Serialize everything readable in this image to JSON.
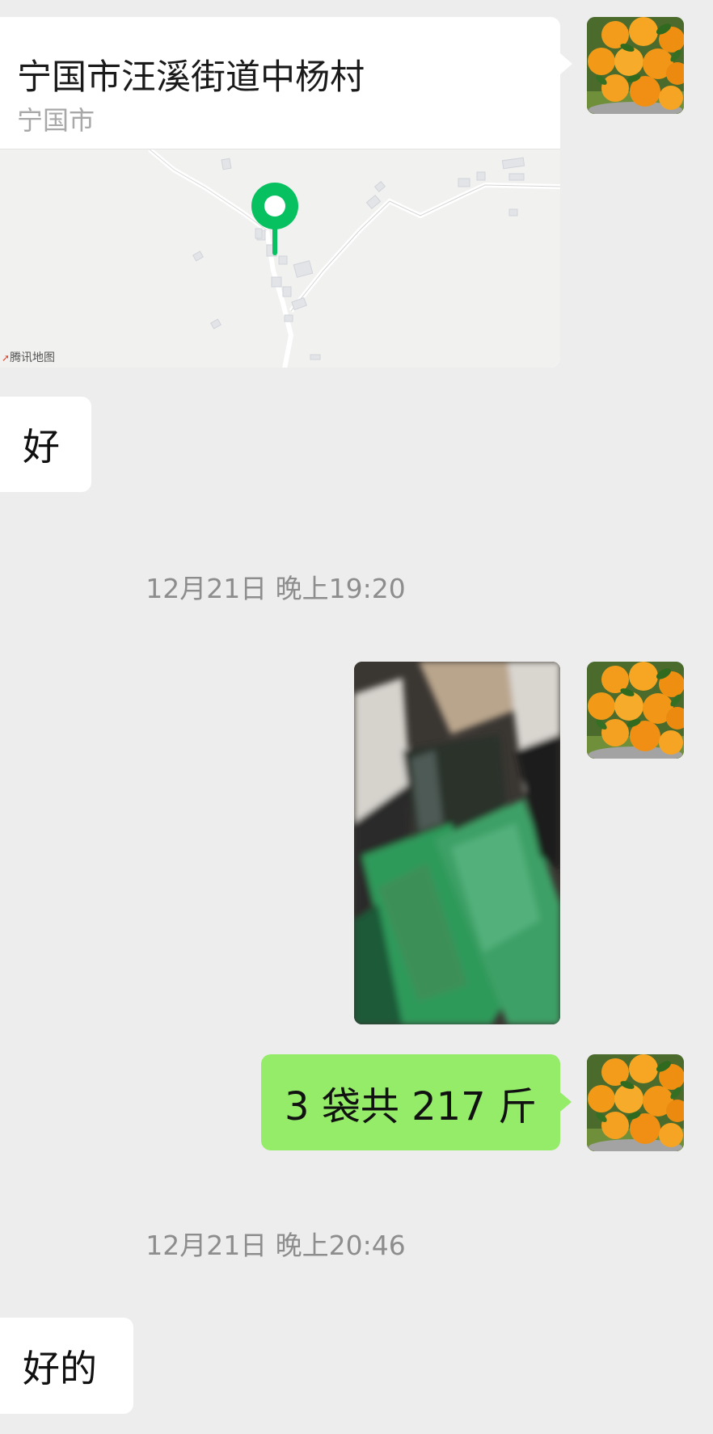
{
  "messages": {
    "location": {
      "title": "宁国市汪溪街道中杨村",
      "subtitle": "宁国市",
      "map_attribution": "腾讯地图"
    },
    "reply_1": "好",
    "timestamp_1": "12月21日 晚上19:20",
    "outgoing_text": "3 袋共 217 斤",
    "timestamp_2": "12月21日 晚上20:46",
    "reply_2": "好的"
  },
  "colors": {
    "background": "#ededed",
    "incoming_bubble": "#ffffff",
    "outgoing_bubble": "#95ec69",
    "map_pin": "#07c160",
    "timestamp_text": "#8d8d8d"
  },
  "icons": {
    "map_pin": "location-pin-icon",
    "avatar": "oranges-avatar"
  }
}
